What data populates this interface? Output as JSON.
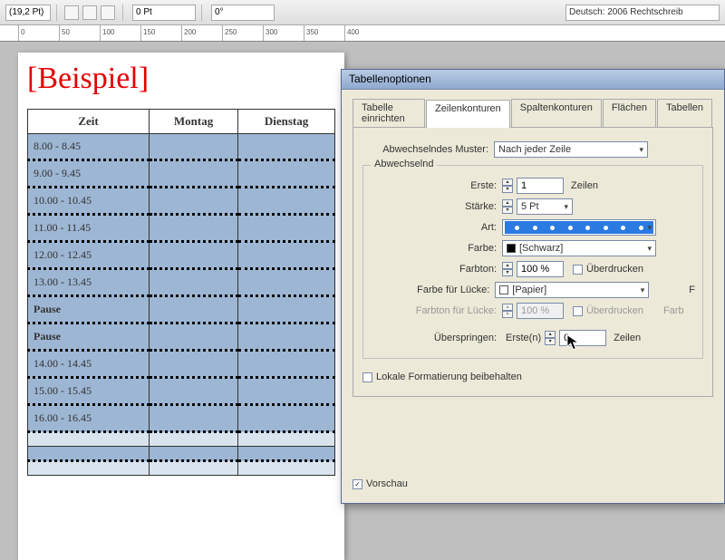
{
  "toolbar": {
    "font_size_value": "(19,2 Pt)",
    "kerning_value": "0 Pt",
    "angle_value": "0°",
    "language": "Deutsch: 2006 Rechtschreib"
  },
  "ruler": {
    "ticks": [
      "0",
      "50",
      "100",
      "150",
      "200",
      "250",
      "300",
      "350",
      "400"
    ]
  },
  "doc": {
    "heading": "[Beispiel]",
    "table": {
      "headers": [
        "Zeit",
        "Montag",
        "Dienstag"
      ],
      "rows": [
        {
          "label": "8.00 - 8.45"
        },
        {
          "label": "9.00 - 9.45"
        },
        {
          "label": "10.00 - 10.45"
        },
        {
          "label": "11.00 - 11.45"
        },
        {
          "label": "12.00 - 12.45"
        },
        {
          "label": "13.00 - 13.45"
        },
        {
          "label": "Pause",
          "bold": true
        },
        {
          "label": "Pause",
          "bold": true
        },
        {
          "label": "14.00 - 14.45"
        },
        {
          "label": "15.00 - 15.45"
        },
        {
          "label": "16.00 - 16.45"
        }
      ]
    }
  },
  "dialog": {
    "title": "Tabellenoptionen",
    "tabs": [
      "Tabelle einrichten",
      "Zeilenkonturen",
      "Spaltenkonturen",
      "Flächen",
      "Tabellen"
    ],
    "active_tab": 1,
    "pattern": {
      "label": "Abwechselndes Muster:",
      "value": "Nach jeder Zeile"
    },
    "group_label": "Abwechselnd",
    "fields": {
      "erste": {
        "label": "Erste:",
        "value": "1",
        "unit": "Zeilen"
      },
      "staerke": {
        "label": "Stärke:",
        "value": "5 Pt"
      },
      "art": {
        "label": "Art:"
      },
      "farbe": {
        "label": "Farbe:",
        "value": "[Schwarz]",
        "swatch": "#000"
      },
      "farbton": {
        "label": "Farbton:",
        "value": "100 %",
        "overprint_label": "Überdrucken"
      },
      "farbe_luecke": {
        "label": "Farbe für Lücke:",
        "value": "[Papier]",
        "swatch": "#fff"
      },
      "farbton_luecke": {
        "label": "Farbton für Lücke:",
        "value": "100 %",
        "overprint_label": "Überdrucken"
      },
      "ueberspringen": {
        "label": "Überspringen:",
        "prefix": "Erste(n)",
        "value": "0",
        "unit": "Zeilen"
      }
    },
    "right_hints": {
      "f": "F",
      "farb": "Farb"
    },
    "local_fmt": {
      "label": "Lokale Formatierung beibehalten",
      "checked": false
    },
    "preview": {
      "label": "Vorschau",
      "checked": true
    }
  }
}
